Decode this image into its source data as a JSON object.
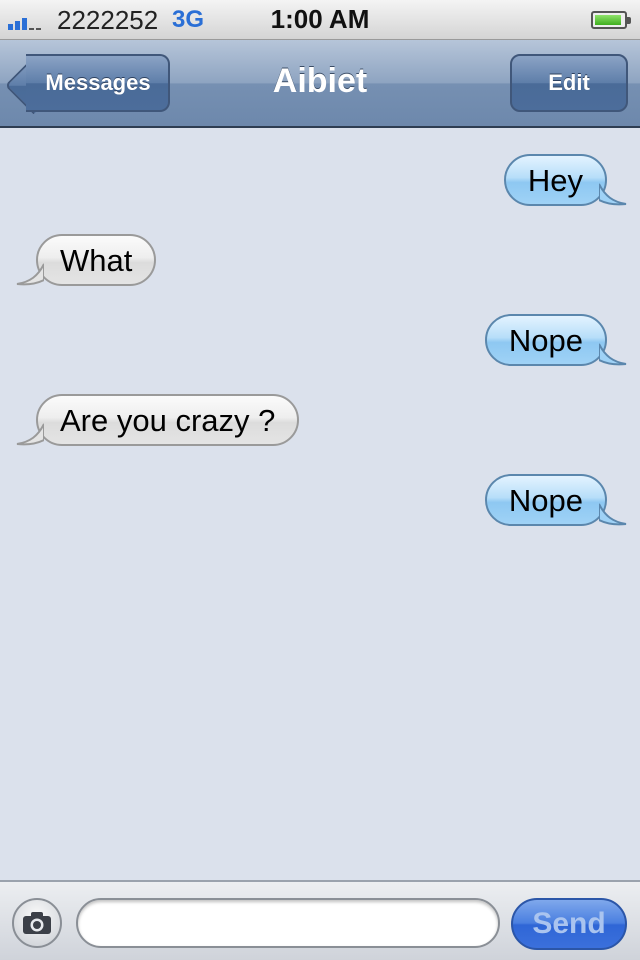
{
  "status_bar": {
    "carrier": "2222252",
    "network": "3G",
    "time": "1:00 AM",
    "signal_bars": 3,
    "signal_bars_total": 5,
    "battery_icon": "battery-icon"
  },
  "nav": {
    "back_label": "Messages",
    "title": "Aibiet",
    "edit_label": "Edit"
  },
  "messages": [
    {
      "direction": "sent",
      "text": "Hey"
    },
    {
      "direction": "received",
      "text": "What"
    },
    {
      "direction": "sent",
      "text": "Nope"
    },
    {
      "direction": "received",
      "text": "Are you crazy ?"
    },
    {
      "direction": "sent",
      "text": "Nope"
    }
  ],
  "composer": {
    "camera_icon": "camera-icon",
    "input_value": "",
    "input_placeholder": "",
    "send_label": "Send"
  },
  "colors": {
    "background": "#dbe1ec",
    "sent_bubble": "#9fd2f6",
    "received_bubble": "#e4e4e4",
    "nav_bar": "#7690b2",
    "send_button": "#3b70dc",
    "accent": "#2a6fd6"
  }
}
